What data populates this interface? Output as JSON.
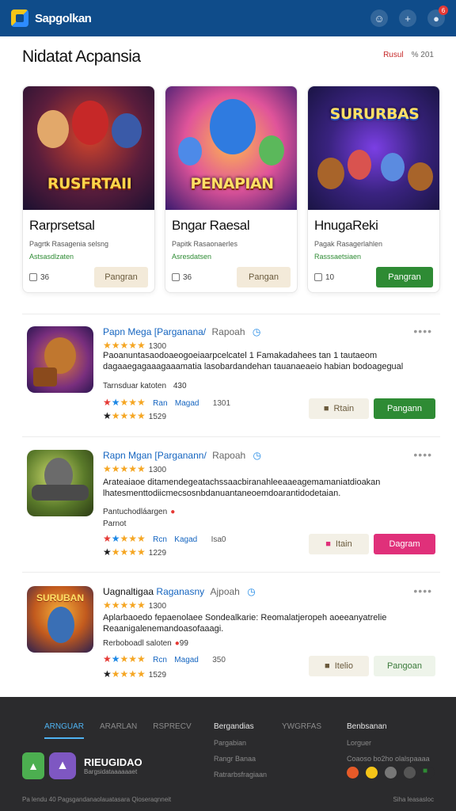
{
  "header": {
    "brand": "Sapgolkan",
    "notification_count": "6"
  },
  "page": {
    "title": "Nidatat Acpansia",
    "meta_red": "Rusul",
    "meta_gray": "% 201"
  },
  "featured": [
    {
      "art_text": "RUSFRTAII",
      "title": "Rarprsetsal",
      "sub": "Pagrtk Rasagenia selsng",
      "sub2": "Astsasdlzaten",
      "count": "36",
      "button": "Pangran",
      "button_style": "light"
    },
    {
      "art_text": "PENAPIAN",
      "title": "Bngar Raesal",
      "sub": "Papitk Rasaonaerles",
      "sub2": "Asresdatsen",
      "count": "36",
      "button": "Pangan",
      "button_style": "light"
    },
    {
      "art_text": "SURURBAS",
      "title": "HnugaReki",
      "sub": "Pagak Rasagerlahlen",
      "sub2": "Rasssaetsiaen",
      "count": "10",
      "button": "Pangran",
      "button_style": "green"
    }
  ],
  "items": [
    {
      "title_a": "Papn",
      "title_b": "Mega",
      "title_c": "[Parganana/",
      "title_d": "Rapoah",
      "rating_line": "1300",
      "desc": "Paoanuntasaodoaeogoeiaarpcelcatel 1 Famakadahees tan 1 tautaeom dagaaegagaaagaaamatia lasobardandehan tauanaeaeio habian bodoagegual",
      "meta": "Tarnsduar katoten",
      "meta_num": "430",
      "rating_label": "Ran",
      "rating_label_2": "Magad",
      "rating_count": "1301",
      "bottom_count": "1529",
      "btn_left": "Rtain",
      "btn_right": "Pangann",
      "btn_right_color": "#2e8b34"
    },
    {
      "title_a": "Rapn",
      "title_b": "Mgan",
      "title_c": "[Parganann/",
      "title_d": "Rapoah",
      "rating_line": "1300",
      "desc": "Arateaiaoe ditamendegeatachssaacbiranahleeaaeagemamaniatdioakan lhatesmenttodiicmecsosnbdanuantaneoemdoarantidodetaian.",
      "meta": "Pantuchodláargen",
      "meta_num": "",
      "meta_2": "Parnot",
      "rating_label": "Rcn",
      "rating_label_2": "Kagad",
      "rating_count": "Isa0",
      "bottom_count": "1229",
      "btn_left": "Itain",
      "btn_right": "Dagram",
      "btn_right_color": "#e0307a"
    },
    {
      "title_a": "Uagnaltigaa",
      "title_b": "",
      "title_c": "Raganasny",
      "title_d": "Ajpoah",
      "rating_line": "1300",
      "desc": "Aplarbaoedo fepaenolaee Sondealkarie: Reomalatjeropeh aoeeanyatrelie Reaanigalenemandoasofaaagi.",
      "meta": "Rerboboadl saloten",
      "meta_num": "99",
      "rating_label": "Rcn",
      "rating_label_2": "Magad",
      "rating_count": "350",
      "bottom_count": "1529",
      "btn_left": "Itelio",
      "btn_right": "Pangoan",
      "btn_right_color": "#eef4ea"
    }
  ],
  "footer": {
    "tabs": [
      "ARNGUAR",
      "ARARLAN",
      "RSPRECV"
    ],
    "col1_head": "Bergandias",
    "col1_links": [
      "Pargabian",
      "Rangr Banaa",
      "Ratrarbsfragiaan"
    ],
    "col2_head": "YWGRFAS",
    "col3_head": "Benbsanan",
    "col3_links": [
      "Lorguer",
      "Coaoso bo2ho olalspaaaa"
    ],
    "brand_name": "RIEUGIDAO",
    "brand_sub": "Bargsidataaaaaaet",
    "bottom_left": "Pa lendu 40 Pagsgandanaolauatasara Qioseraqnneit",
    "bottom_right": "Siha leasasloc"
  }
}
